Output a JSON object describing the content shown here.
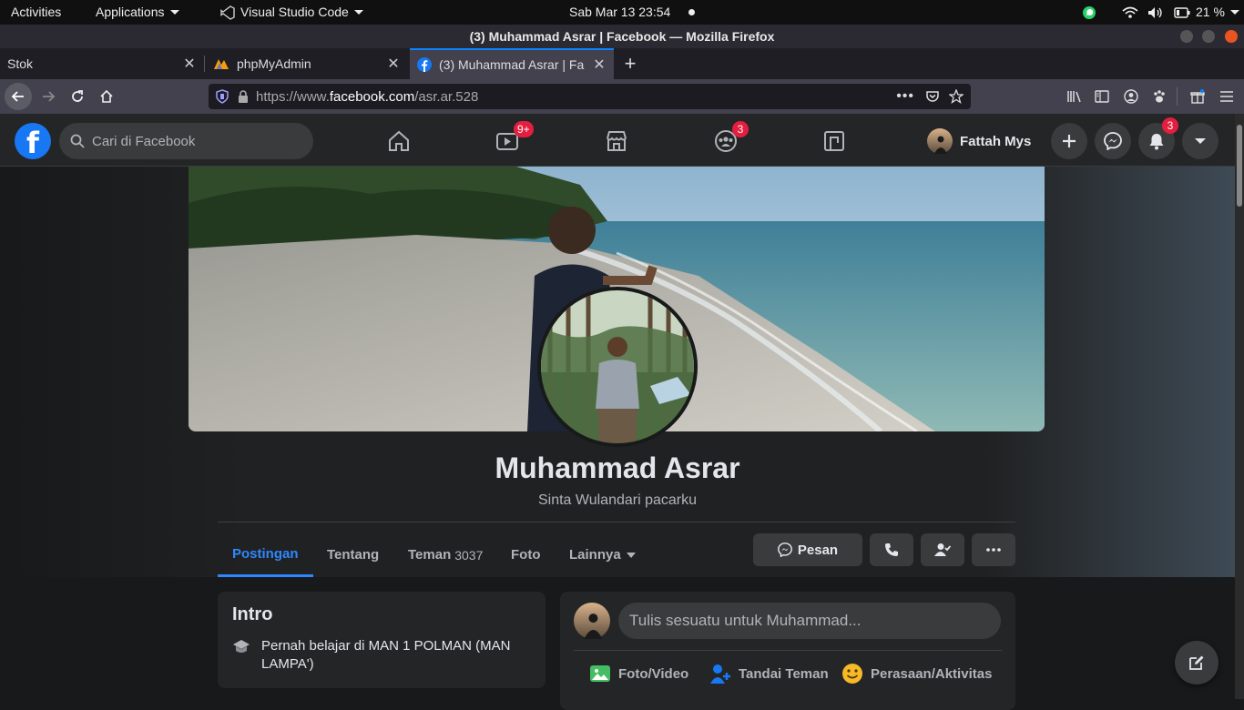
{
  "gnome": {
    "activities": "Activities",
    "applications": "Applications",
    "active_app": "Visual Studio Code",
    "clock": "Sab Mar 13  23:54",
    "battery": "21 %"
  },
  "firefox": {
    "window_title": "(3) Muhammad Asrar | Facebook — Mozilla Firefox",
    "tabs": [
      {
        "label": "Stok"
      },
      {
        "label": "phpMyAdmin"
      },
      {
        "label": "(3) Muhammad Asrar | Fa"
      }
    ],
    "url_prefix": "https://www.",
    "url_domain": "facebook.com",
    "url_path": "/asr.ar.528"
  },
  "facebook": {
    "logo": "f",
    "search_placeholder": "Cari di Facebook",
    "badges": {
      "watch": "9+",
      "groups": "3",
      "notifications": "3"
    },
    "user_name": "Fattah Mys",
    "colors": {
      "brand": "#1877f2",
      "active_tab": "#2d88ff",
      "badge": "#e41e3f"
    }
  },
  "profile": {
    "name": "Muhammad Asrar",
    "bio": "Sinta Wulandari pacarku",
    "tabs": [
      {
        "label": "Postingan"
      },
      {
        "label": "Tentang"
      },
      {
        "label": "Teman",
        "count": "3037"
      },
      {
        "label": "Foto"
      },
      {
        "label": "Lainnya"
      }
    ],
    "message_button": "Pesan"
  },
  "intro": {
    "title": "Intro",
    "education": "Pernah belajar di MAN 1 POLMAN (MAN LAMPA')"
  },
  "composer": {
    "placeholder": "Tulis sesuatu untuk Muhammad...",
    "actions": [
      {
        "label": "Foto/Video"
      },
      {
        "label": "Tandai Teman"
      },
      {
        "label": "Perasaan/Aktivitas"
      }
    ]
  }
}
